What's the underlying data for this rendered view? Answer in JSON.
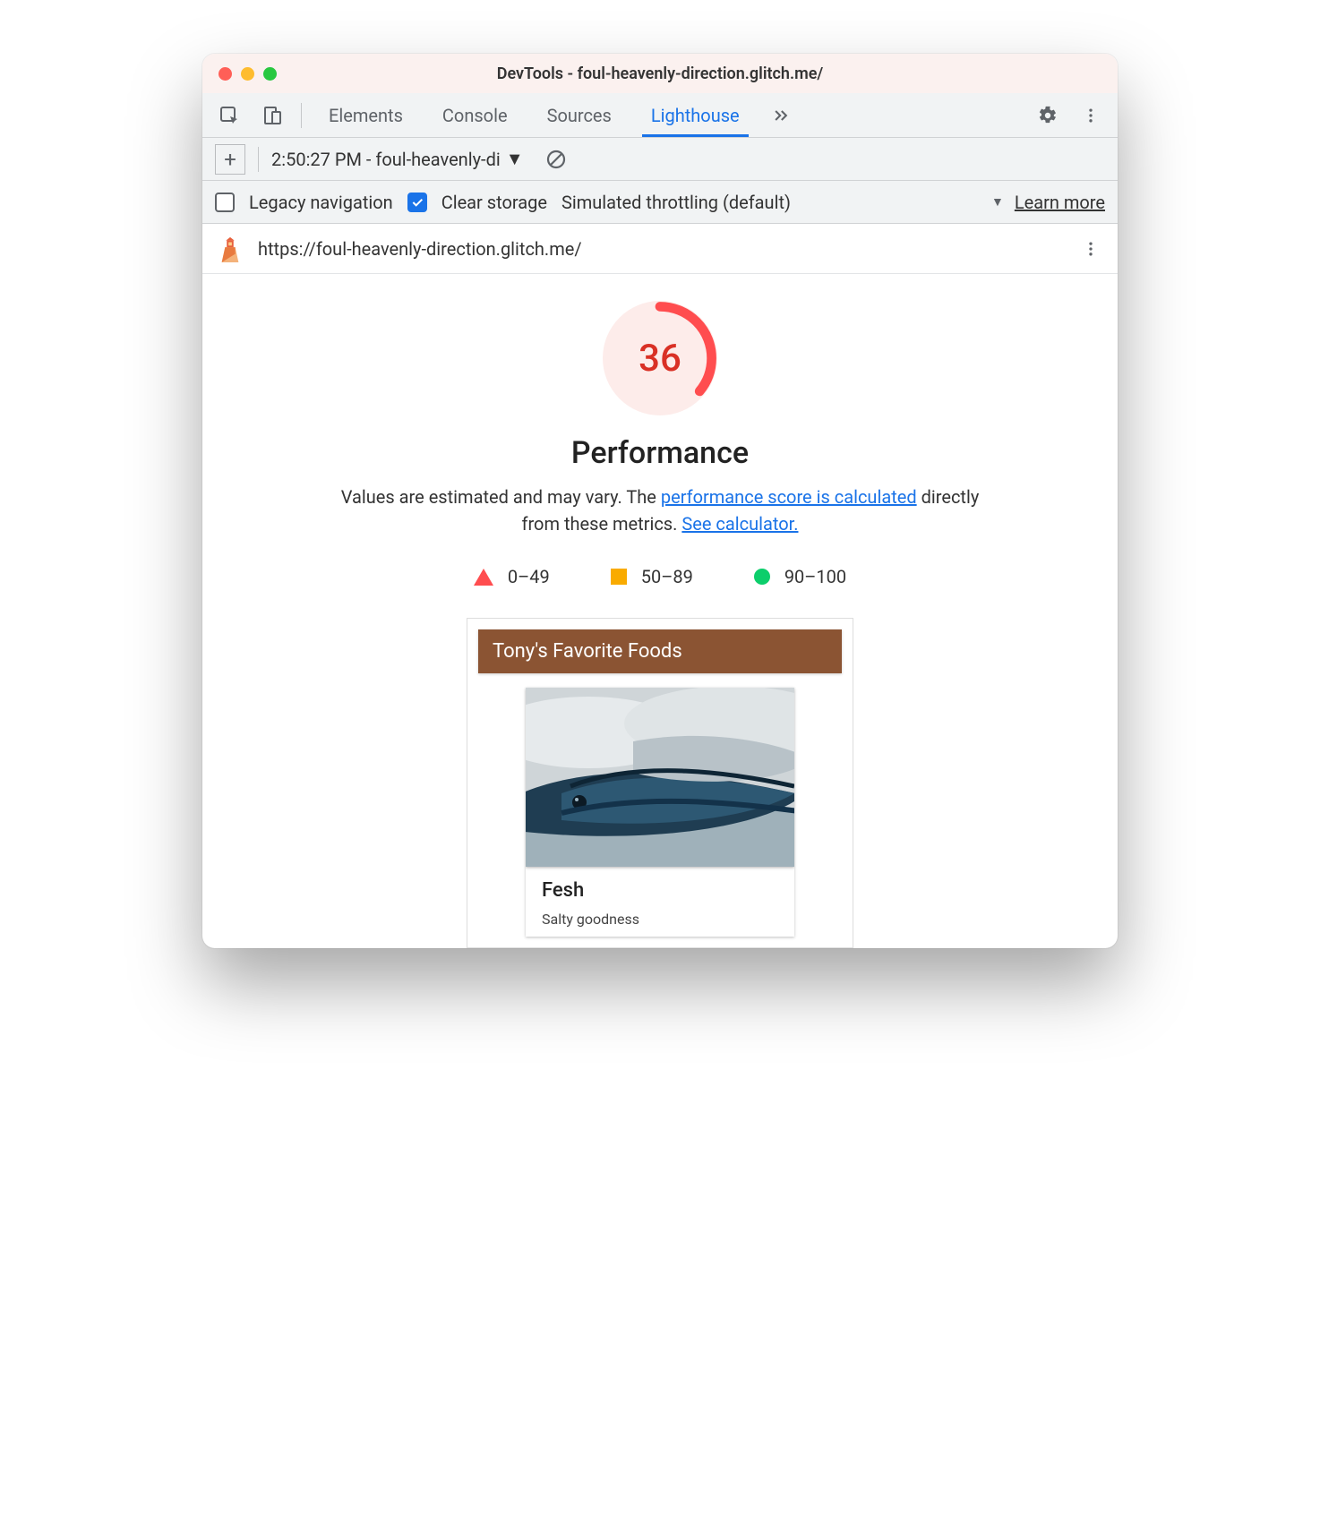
{
  "window": {
    "title": "DevTools - foul-heavenly-direction.glitch.me/"
  },
  "tabs": {
    "items": [
      "Elements",
      "Console",
      "Sources",
      "Lighthouse"
    ],
    "active": "Lighthouse"
  },
  "toolbar1": {
    "report_selector": "2:50:27 PM - foul-heavenly-di"
  },
  "toolbar2": {
    "legacy_label": "Legacy navigation",
    "legacy_checked": false,
    "clear_label": "Clear storage",
    "clear_checked": true,
    "throttling_label": "Simulated throttling (default)",
    "learn_more": "Learn more"
  },
  "urlbar": {
    "url": "https://foul-heavenly-direction.glitch.me/"
  },
  "report": {
    "score": "36",
    "score_numeric": 36,
    "category": "Performance",
    "desc_pre": "Values are estimated and may vary. The ",
    "desc_link1": "performance score is calculated",
    "desc_mid": " directly from these metrics. ",
    "desc_link2": "See calculator.",
    "legend": {
      "low": "0–49",
      "mid": "50–89",
      "high": "90–100"
    },
    "colors": {
      "low": "#ff4d4f",
      "mid": "#f9ab00",
      "high": "#0cce6b"
    }
  },
  "screenshot": {
    "banner": "Tony's Favorite Foods",
    "card_title": "Fesh",
    "card_sub": "Salty goodness"
  }
}
